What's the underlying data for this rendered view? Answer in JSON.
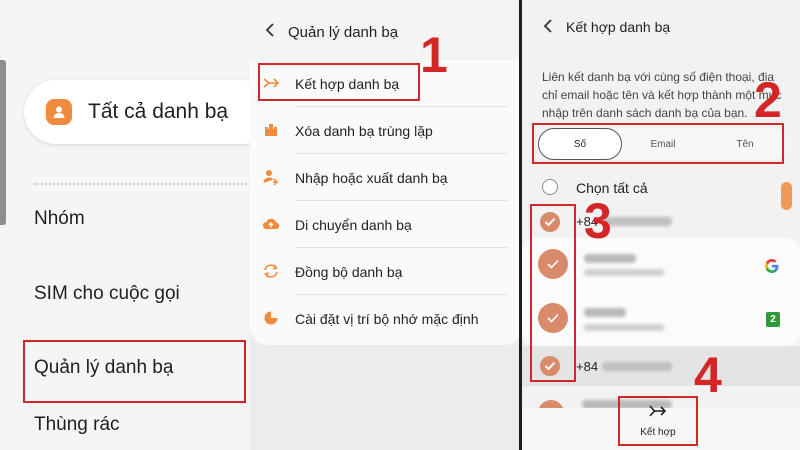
{
  "panel1": {
    "all_contacts": "Tất cả danh bạ",
    "menu": [
      "Nhóm",
      "SIM cho cuộc gọi",
      "Quản lý danh bạ",
      "Thùng rác"
    ]
  },
  "panel2": {
    "title": "Quản lý danh bạ",
    "items": [
      {
        "label": "Kết hợp danh bạ",
        "icon": "merge-icon"
      },
      {
        "label": "Xóa danh bạ trùng lặp",
        "icon": "duplicate-icon"
      },
      {
        "label": "Nhập hoặc xuất danh bạ",
        "icon": "import-export-icon"
      },
      {
        "label": "Di chuyển danh bạ",
        "icon": "cloud-upload-icon"
      },
      {
        "label": "Đồng bộ danh bạ",
        "icon": "sync-icon"
      },
      {
        "label": "Cài đặt vị trí bộ nhớ mặc định",
        "icon": "storage-icon"
      }
    ]
  },
  "panel3": {
    "title": "Kết hợp danh bạ",
    "description": "Liên kết danh bạ với cùng số điện thoại, địa chỉ email hoặc tên và kết hợp thành một mục nhập trên danh sách danh bạ của bạn.",
    "tabs": [
      "Số",
      "Email",
      "Tên"
    ],
    "active_tab": "Số",
    "select_all": "Chọn tất cả",
    "phone_prefix": "+84",
    "merge_label": "Kết hợp"
  },
  "steps": [
    "1",
    "2",
    "3",
    "4"
  ],
  "colors": {
    "accent": "#d98a6b",
    "highlight": "#d32626",
    "orange_icon": "#f08a3c"
  }
}
